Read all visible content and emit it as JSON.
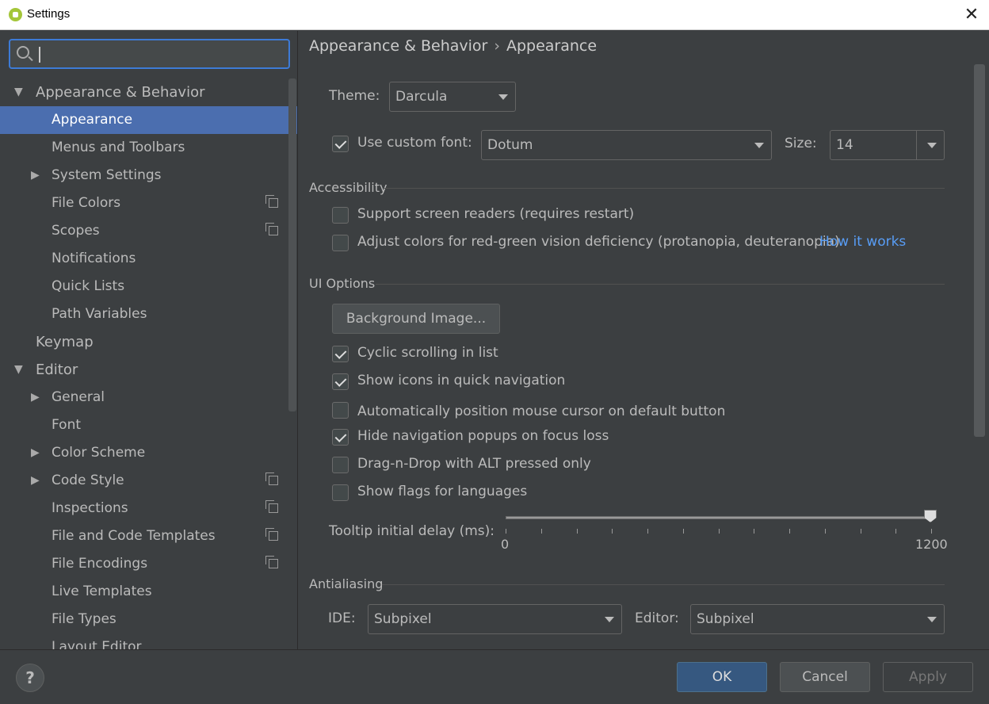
{
  "window": {
    "title": "Settings",
    "close": "✕"
  },
  "search": {
    "value": ""
  },
  "tree": [
    {
      "label": "Appearance & Behavior",
      "expander": "▼"
    },
    {
      "label": "Appearance"
    },
    {
      "label": "Menus and Toolbars"
    },
    {
      "label": "System Settings",
      "expander": "▶"
    },
    {
      "label": "File Colors"
    },
    {
      "label": "Scopes"
    },
    {
      "label": "Notifications"
    },
    {
      "label": "Quick Lists"
    },
    {
      "label": "Path Variables"
    },
    {
      "label": "Keymap"
    },
    {
      "label": "Editor",
      "expander": "▼"
    },
    {
      "label": "General",
      "expander": "▶"
    },
    {
      "label": "Font"
    },
    {
      "label": "Color Scheme",
      "expander": "▶"
    },
    {
      "label": "Code Style",
      "expander": "▶"
    },
    {
      "label": "Inspections"
    },
    {
      "label": "File and Code Templates"
    },
    {
      "label": "File Encodings"
    },
    {
      "label": "Live Templates"
    },
    {
      "label": "File Types"
    },
    {
      "label": "Layout Editor"
    }
  ],
  "breadcrumb": {
    "parent": "Appearance & Behavior",
    "sep": "›",
    "current": "Appearance"
  },
  "theme": {
    "label": "Theme:",
    "value": "Darcula"
  },
  "font": {
    "checkbox_label": "Use custom font:",
    "checked": true,
    "value": "Dotum",
    "size_label": "Size:",
    "size_value": "14"
  },
  "accessibility": {
    "title": "Accessibility",
    "screen_readers": "Support screen readers (requires restart)",
    "color_adjust": "Adjust colors for red-green vision deficiency (protanopia, deuteranopia)",
    "how_it_works": "How it works"
  },
  "ui_options": {
    "title": "UI Options",
    "background_image": "Background Image...",
    "options": [
      {
        "label": "Cyclic scrolling in list",
        "checked": true
      },
      {
        "label": "Show icons in quick navigation",
        "checked": true
      },
      {
        "label": "Automatically position mouse cursor on default button",
        "checked": false
      },
      {
        "label": "Hide navigation popups on focus loss",
        "checked": true
      },
      {
        "label": "Drag-n-Drop with ALT pressed only",
        "checked": false
      },
      {
        "label": "Show flags for languages",
        "checked": false
      }
    ],
    "tooltip_label": "Tooltip initial delay (ms):",
    "tooltip_min": "0",
    "tooltip_max": "1200",
    "tooltip_value": 1200
  },
  "antialiasing": {
    "title": "Antialiasing",
    "ide_label": "IDE:",
    "ide_value": "Subpixel",
    "editor_label": "Editor:",
    "editor_value": "Subpixel"
  },
  "buttons": {
    "help": "?",
    "ok": "OK",
    "cancel": "Cancel",
    "apply": "Apply"
  }
}
